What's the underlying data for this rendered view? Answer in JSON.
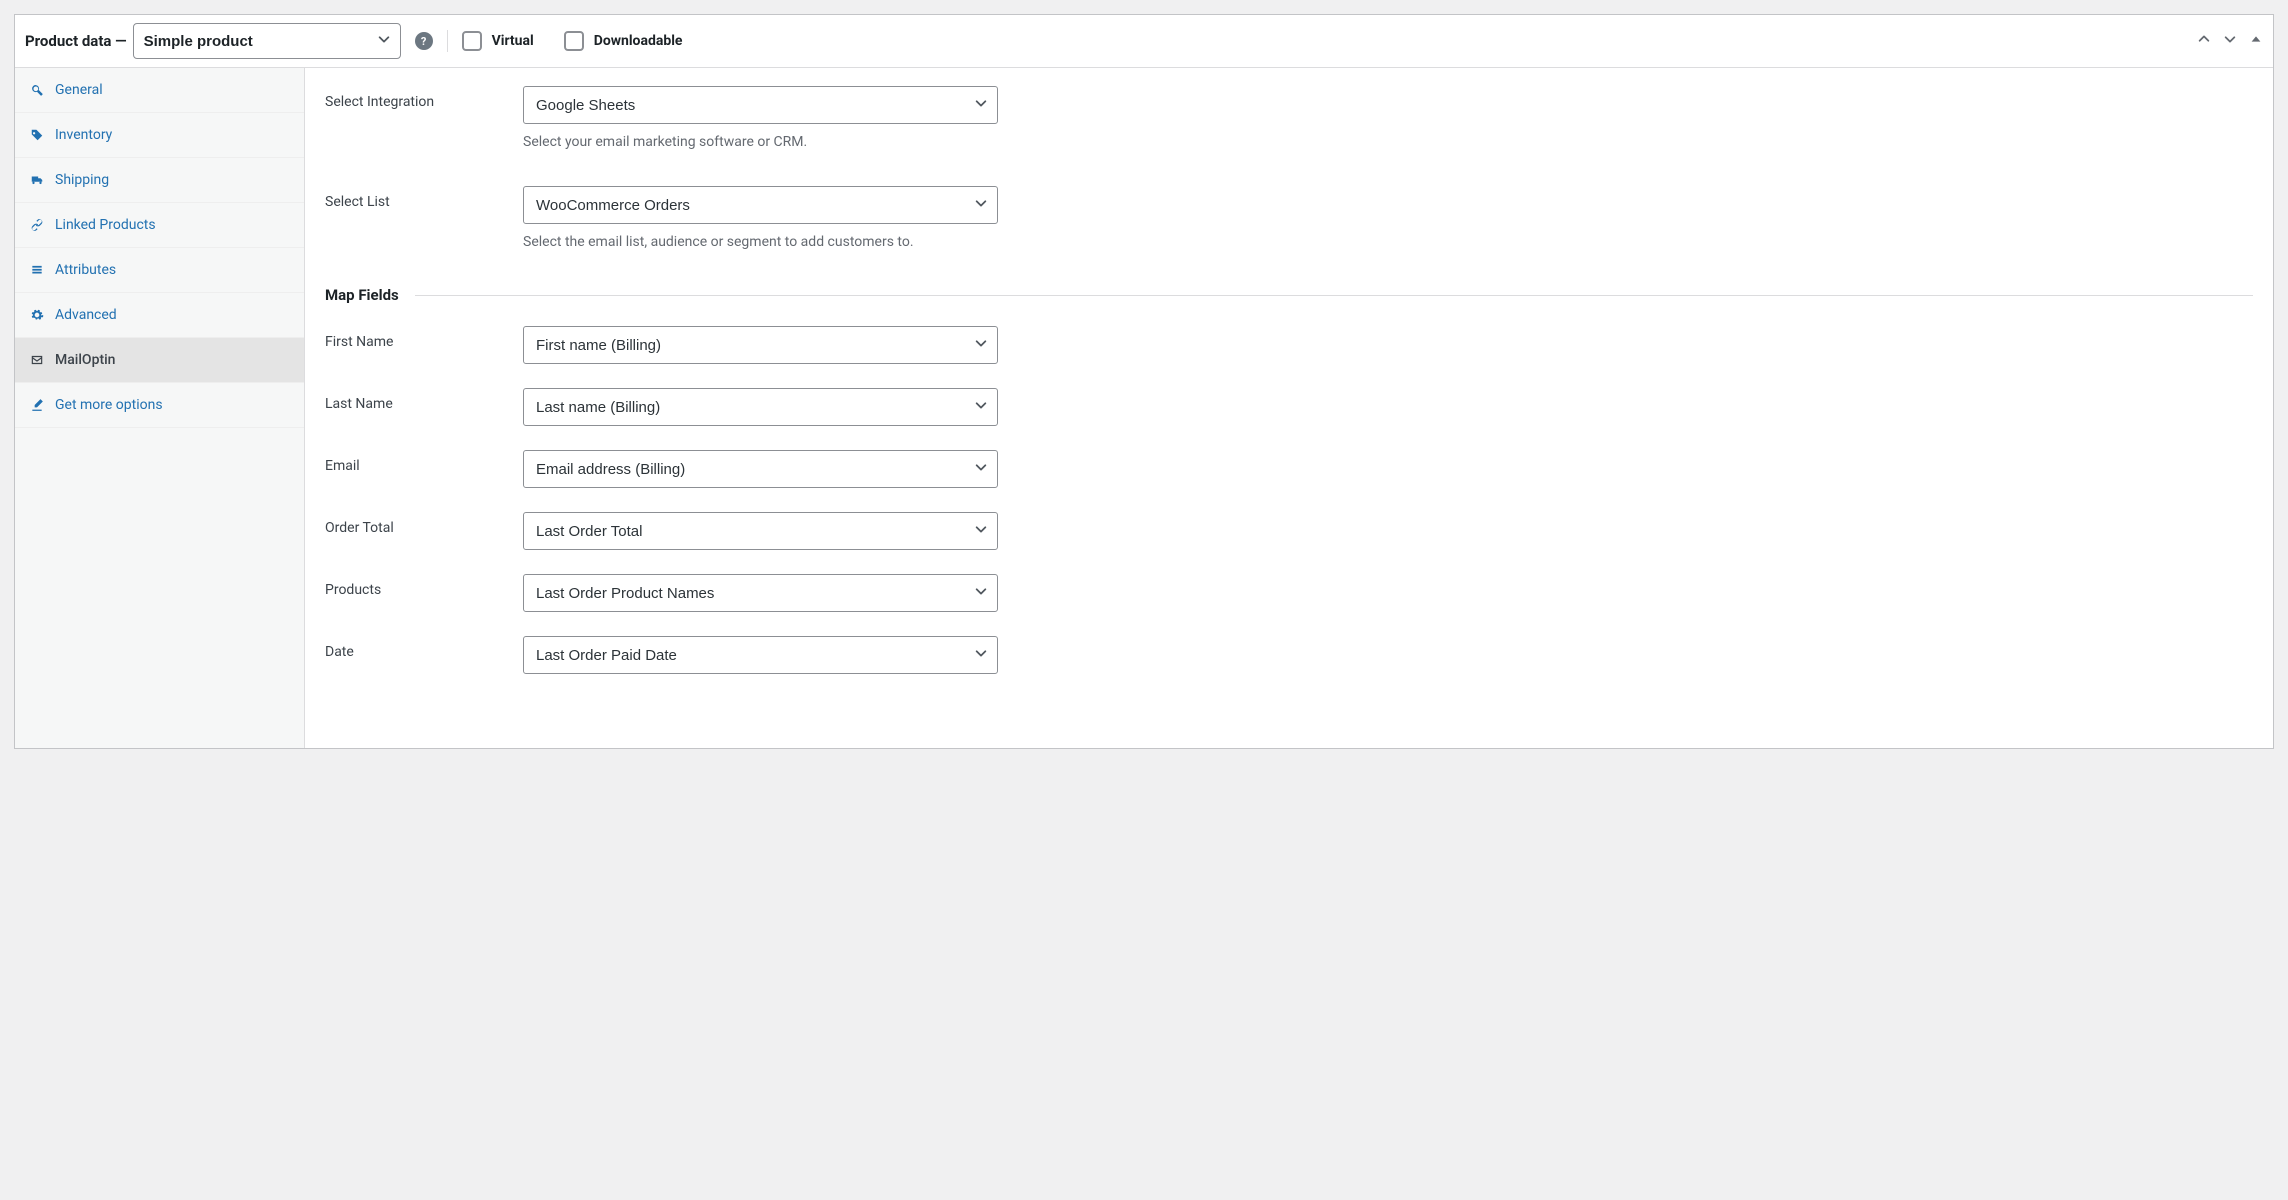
{
  "header": {
    "title_prefix": "Product data —",
    "product_type_selected": "Simple product",
    "virtual_label": "Virtual",
    "downloadable_label": "Downloadable"
  },
  "sidebar": {
    "items": [
      {
        "label": "General",
        "slug": "general",
        "icon": "wrench"
      },
      {
        "label": "Inventory",
        "slug": "inventory",
        "icon": "tag"
      },
      {
        "label": "Shipping",
        "slug": "shipping",
        "icon": "truck"
      },
      {
        "label": "Linked Products",
        "slug": "linked-products",
        "icon": "link"
      },
      {
        "label": "Attributes",
        "slug": "attributes",
        "icon": "list"
      },
      {
        "label": "Advanced",
        "slug": "advanced",
        "icon": "gear"
      },
      {
        "label": "MailOptin",
        "slug": "mailoptin",
        "icon": "mail",
        "active": true
      },
      {
        "label": "Get more options",
        "slug": "more-options",
        "icon": "paint"
      }
    ]
  },
  "content": {
    "select_integration": {
      "label": "Select Integration",
      "value": "Google Sheets",
      "help": "Select your email marketing software or CRM."
    },
    "select_list": {
      "label": "Select List",
      "value": "WooCommerce Orders",
      "help": "Select the email list, audience or segment to add customers to."
    },
    "map_fields_heading": "Map Fields",
    "map_fields": [
      {
        "label": "First Name",
        "value": "First name (Billing)"
      },
      {
        "label": "Last Name",
        "value": "Last name (Billing)"
      },
      {
        "label": "Email",
        "value": "Email address (Billing)"
      },
      {
        "label": "Order Total",
        "value": "Last Order Total"
      },
      {
        "label": "Products",
        "value": "Last Order Product Names"
      },
      {
        "label": "Date",
        "value": "Last Order Paid Date"
      }
    ]
  }
}
